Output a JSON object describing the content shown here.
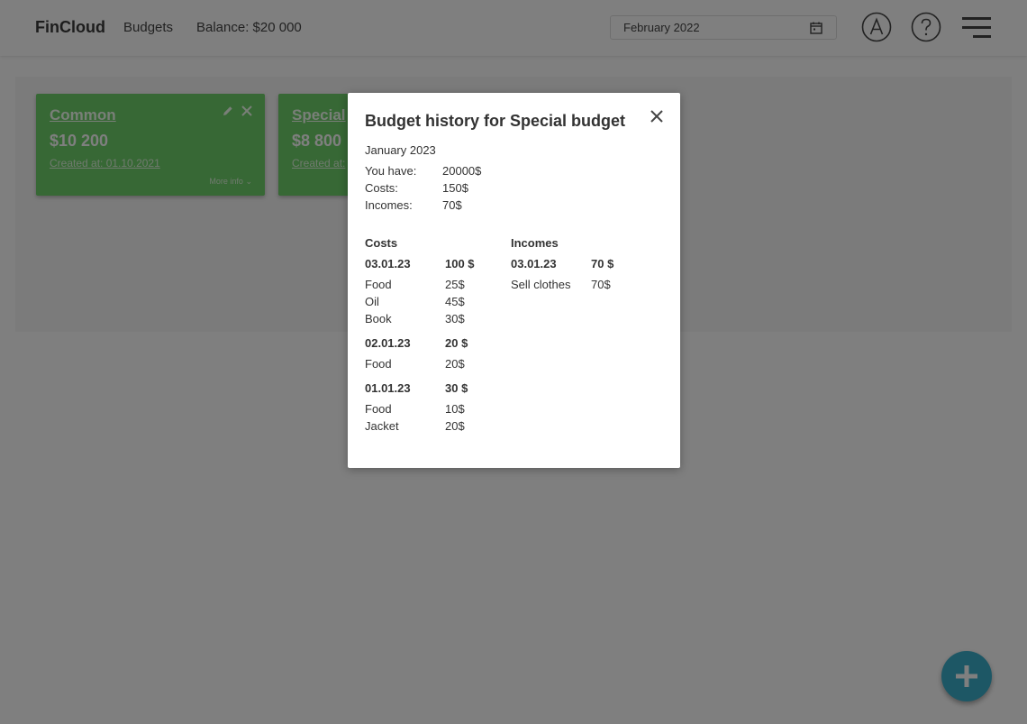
{
  "header": {
    "brand": "FinCloud",
    "nav_budgets": "Budgets",
    "balance": "Balance: $20 000",
    "date_value": "February 2022",
    "account_icon": "account-circle-icon",
    "help_icon": "help-circle-icon",
    "menu_icon": "hamburger-menu-icon"
  },
  "cards": [
    {
      "name": "Common",
      "amount": "$10 200",
      "created": "Created at: 01.10.2021",
      "more": "More info"
    },
    {
      "name": "Special",
      "amount": "$8 800",
      "created": "Created at:"
    }
  ],
  "fab_icon": "plus-icon",
  "modal": {
    "title": "Budget history for Special budget",
    "period": "January 2023",
    "summary": [
      {
        "label": "You have:",
        "value": "20000$"
      },
      {
        "label": "Costs:",
        "value": "150$"
      },
      {
        "label": "Incomes:",
        "value": "70$"
      }
    ],
    "costs_header": "Costs",
    "incomes_header": "Incomes",
    "costs": [
      {
        "date": "03.01.23",
        "total": "100 $",
        "items": [
          {
            "name": "Food",
            "amount": "25$"
          },
          {
            "name": "Oil",
            "amount": "45$"
          },
          {
            "name": "Book",
            "amount": "30$"
          }
        ]
      },
      {
        "date": "02.01.23",
        "total": "20 $",
        "items": [
          {
            "name": "Food",
            "amount": "20$"
          }
        ]
      },
      {
        "date": "01.01.23",
        "total": "30 $",
        "items": [
          {
            "name": "Food",
            "amount": "10$"
          },
          {
            "name": "Jacket",
            "amount": "20$"
          }
        ]
      }
    ],
    "incomes": [
      {
        "date": "03.01.23",
        "total": "70 $",
        "items": [
          {
            "name": "Sell clothes",
            "amount": "70$"
          }
        ]
      }
    ]
  },
  "colors": {
    "card_green": "#6fd06a",
    "fab_blue": "#3aaecb",
    "overlay": "rgba(0,0,0,0.5)"
  }
}
